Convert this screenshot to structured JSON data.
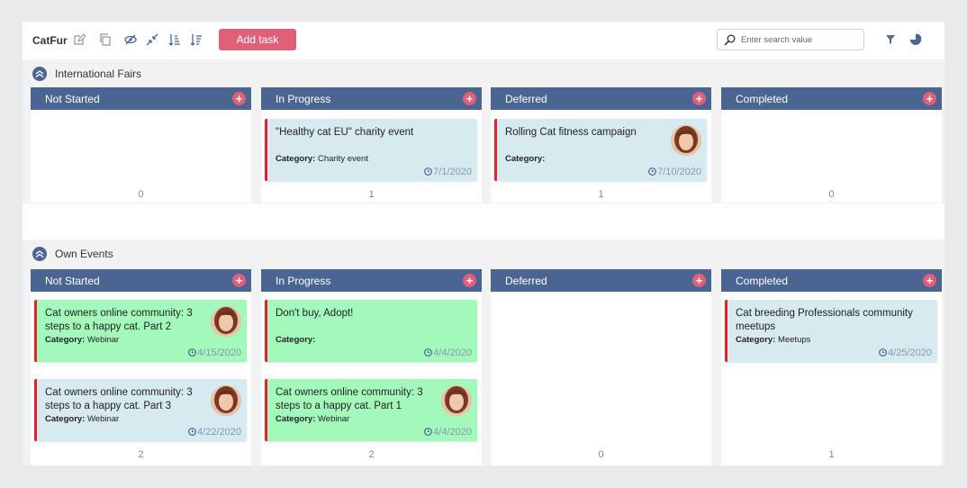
{
  "toolbar": {
    "board_title": "CatFur",
    "add_task_label": "Add task",
    "search_placeholder": "Enter search value"
  },
  "colors": {
    "header": "#4a6591",
    "accent": "#e0607a",
    "card_blue": "#d6eaf0",
    "card_green": "#a3f9bb",
    "card_border": "#e0242c"
  },
  "lanes": [
    {
      "title": "International Fairs",
      "columns": [
        {
          "title": "Not Started",
          "count": "0",
          "cards": []
        },
        {
          "title": "In Progress",
          "count": "1",
          "cards": [
            {
              "title": "\"Healthy cat EU\" charity event",
              "category_label": "Category:",
              "category": "Charity event",
              "date": "7/1/2020",
              "avatar": false
            }
          ]
        },
        {
          "title": "Deferred",
          "count": "1",
          "cards": [
            {
              "title": "Rolling Cat fitness campaign",
              "category_label": "Category:",
              "category": "",
              "date": "7/10/2020",
              "avatar": true
            }
          ]
        },
        {
          "title": "Completed",
          "count": "0",
          "cards": []
        }
      ]
    },
    {
      "title": "Own Events",
      "columns": [
        {
          "title": "Not Started",
          "count": "2",
          "cards": [
            {
              "title": "Cat owners online community: 3 steps to a happy cat. Part 2",
              "category_label": "Category:",
              "category": "Webinar",
              "date": "4/15/2020",
              "avatar": true
            },
            {
              "title": "Cat owners online community: 3 steps to a happy cat. Part 3",
              "category_label": "Category:",
              "category": "Webinar",
              "date": "4/22/2020",
              "avatar": true
            }
          ]
        },
        {
          "title": "In Progress",
          "count": "2",
          "cards": [
            {
              "title": "Don't buy, Adopt!",
              "category_label": "Category:",
              "category": "",
              "date": "4/4/2020",
              "avatar": false
            },
            {
              "title": "Cat owners online community: 3 steps to a happy cat. Part 1",
              "category_label": "Category:",
              "category": "Webinar",
              "date": "4/4/2020",
              "avatar": true
            }
          ]
        },
        {
          "title": "Deferred",
          "count": "0",
          "cards": []
        },
        {
          "title": "Completed",
          "count": "1",
          "cards": [
            {
              "title": "Cat breeding Professionals community meetups",
              "category_label": "Category:",
              "category": "Meetups",
              "date": "4/25/2020",
              "avatar": false
            }
          ]
        }
      ]
    }
  ]
}
